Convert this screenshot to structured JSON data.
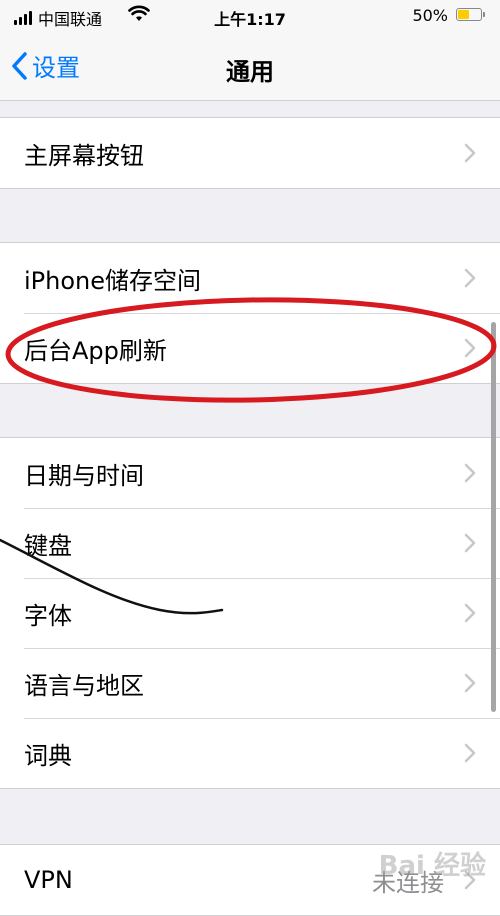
{
  "status_bar": {
    "carrier": "中国联通",
    "time": "上午1:17",
    "battery_pct": "50%",
    "battery_level": 0.5,
    "battery_color": "#ffcc00"
  },
  "nav": {
    "back_label": "设置",
    "title": "通用",
    "accent": "#007aff"
  },
  "groups": [
    {
      "rows": [
        {
          "label": "主屏幕按钮"
        }
      ]
    },
    {
      "rows": [
        {
          "label": "iPhone储存空间"
        },
        {
          "label": "后台App刷新"
        }
      ]
    },
    {
      "rows": [
        {
          "label": "日期与时间"
        },
        {
          "label": "键盘"
        },
        {
          "label": "字体"
        },
        {
          "label": "语言与地区"
        },
        {
          "label": "词典"
        }
      ]
    },
    {
      "rows": [
        {
          "label": "VPN",
          "value": "未连接"
        }
      ]
    }
  ],
  "annotation_color": "#d71920",
  "watermark": "Bai 经验"
}
